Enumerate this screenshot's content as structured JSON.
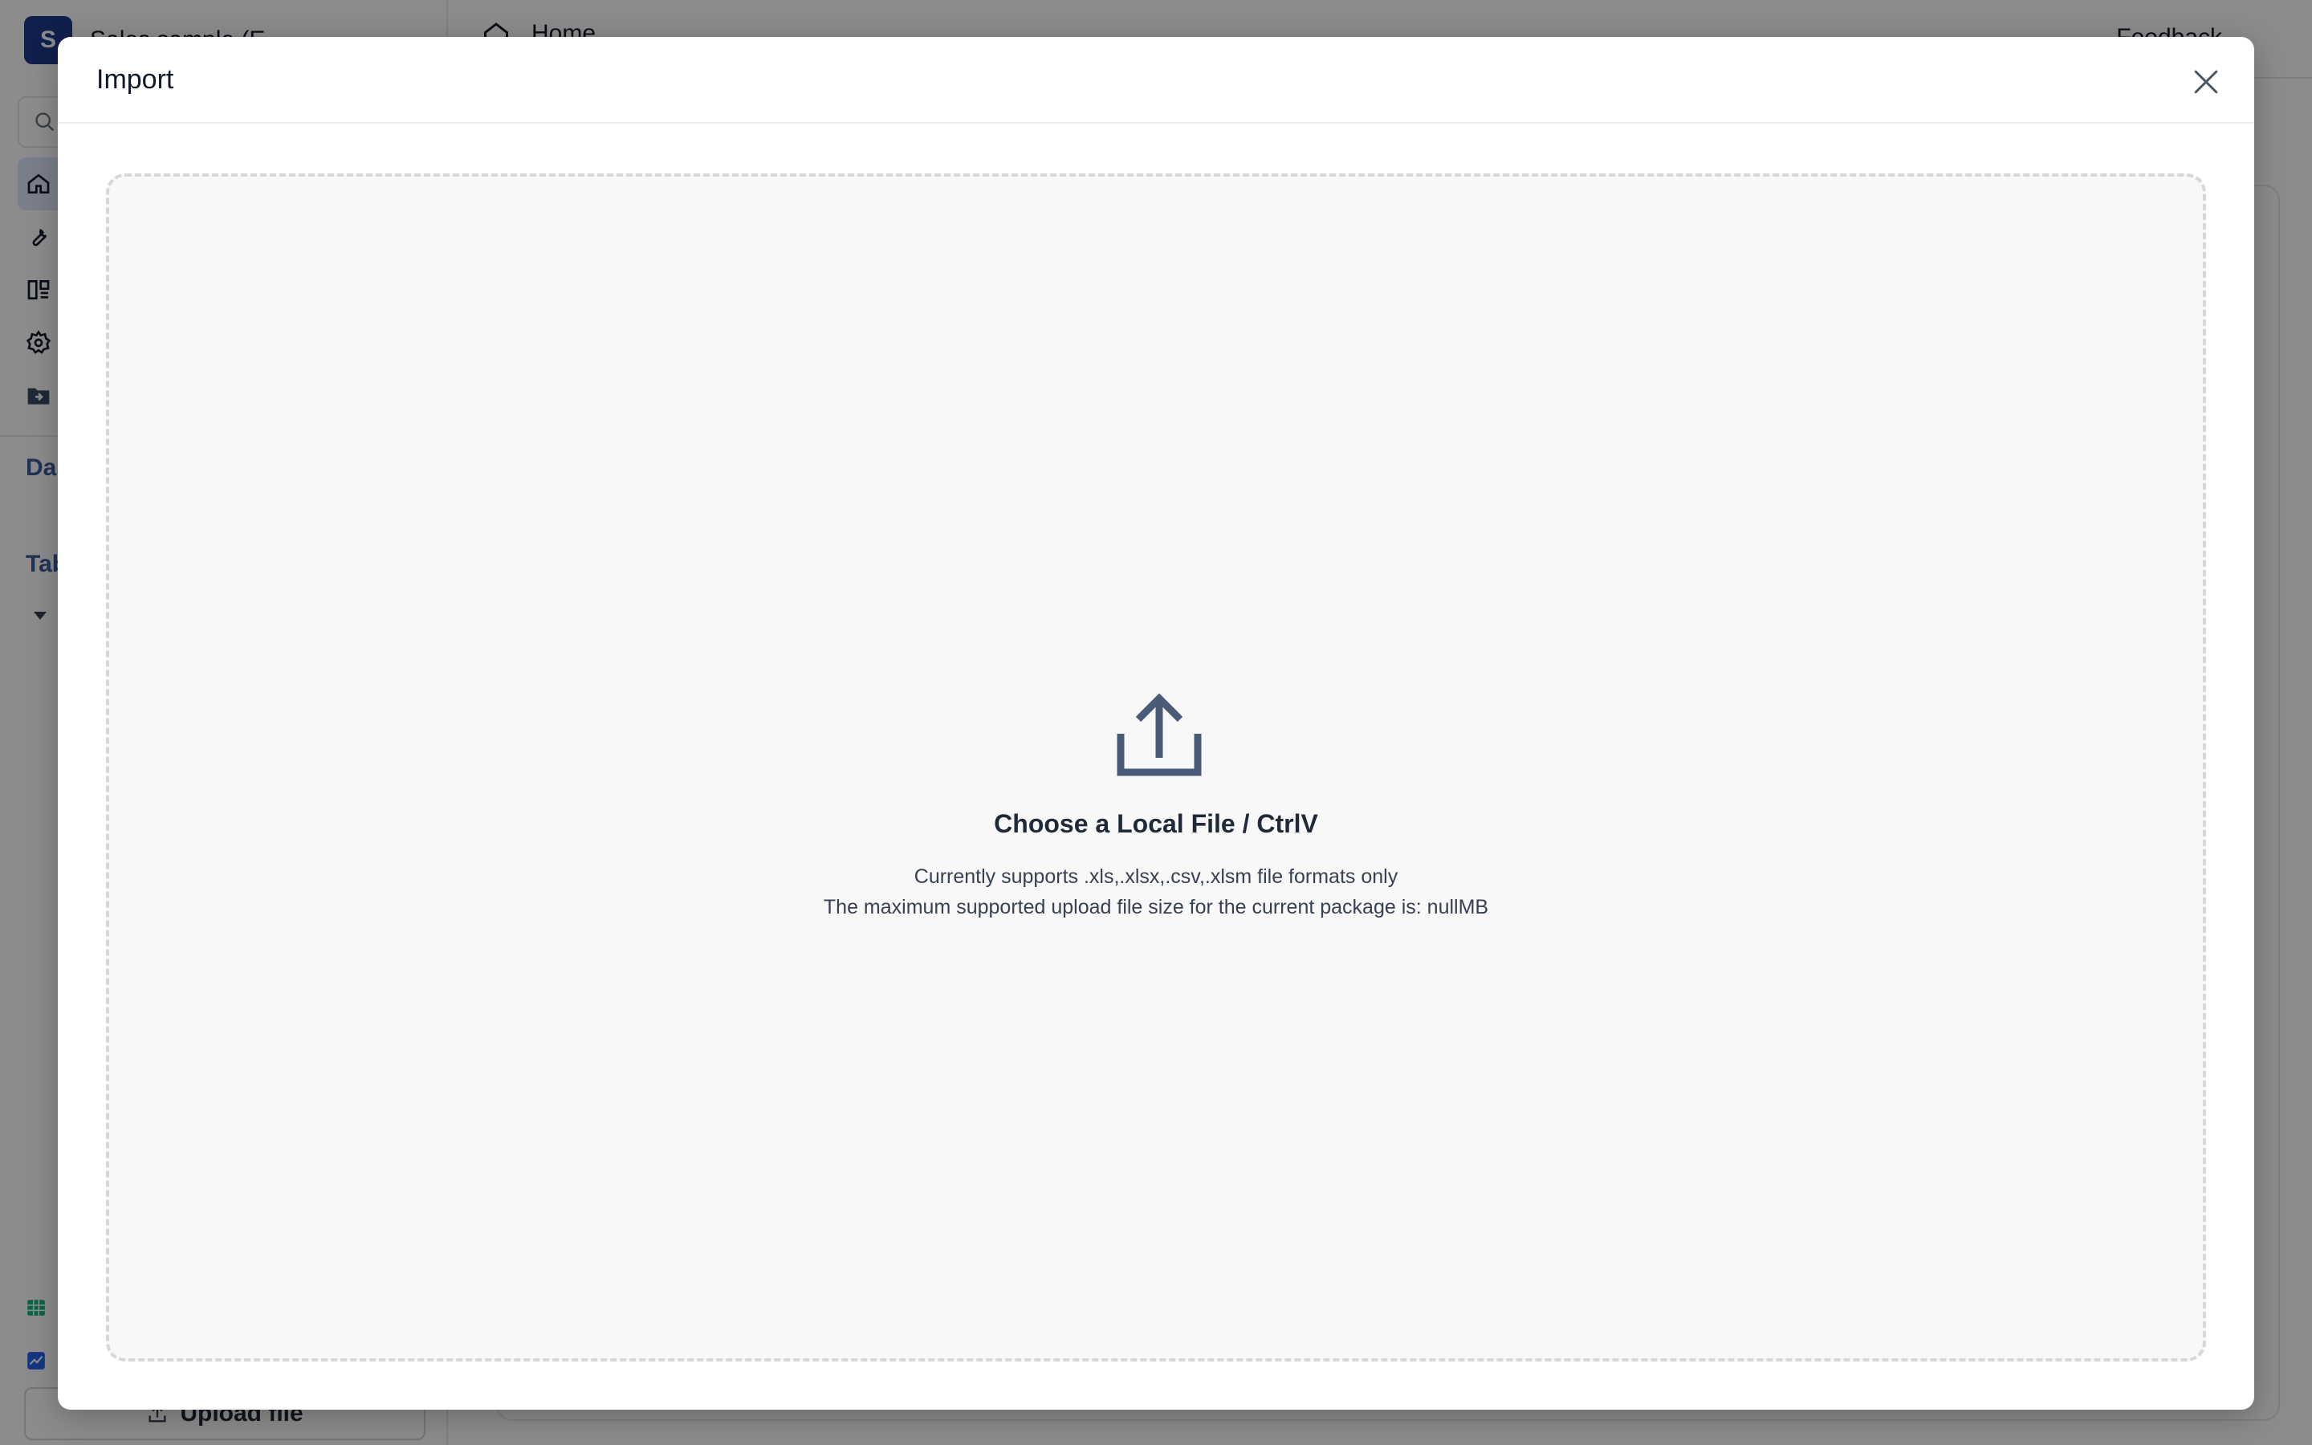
{
  "app": {
    "space": {
      "avatar_letter": "S",
      "name": "Sales sample (E..."
    },
    "search": {
      "placeholder": ""
    },
    "sections": {
      "dashboard": "Das",
      "tables": "Tab"
    },
    "upload_button": "Upload file",
    "topbar": {
      "breadcrumb": "Home",
      "feedback": "Feedback"
    }
  },
  "modal": {
    "title": "Import",
    "dropzone": {
      "title": "Choose a Local File / CtrlV",
      "formats_line": "Currently supports .xls,.xlsx,.csv,.xlsm file formats only",
      "size_line": "The maximum supported upload file size for the current package is: nullMB"
    }
  },
  "colors": {
    "overlay": "#000000",
    "upload_icon": "#4a5b78",
    "accent": "#1e3a8a"
  },
  "icons": {
    "close": "close-icon",
    "upload": "upload-icon"
  }
}
